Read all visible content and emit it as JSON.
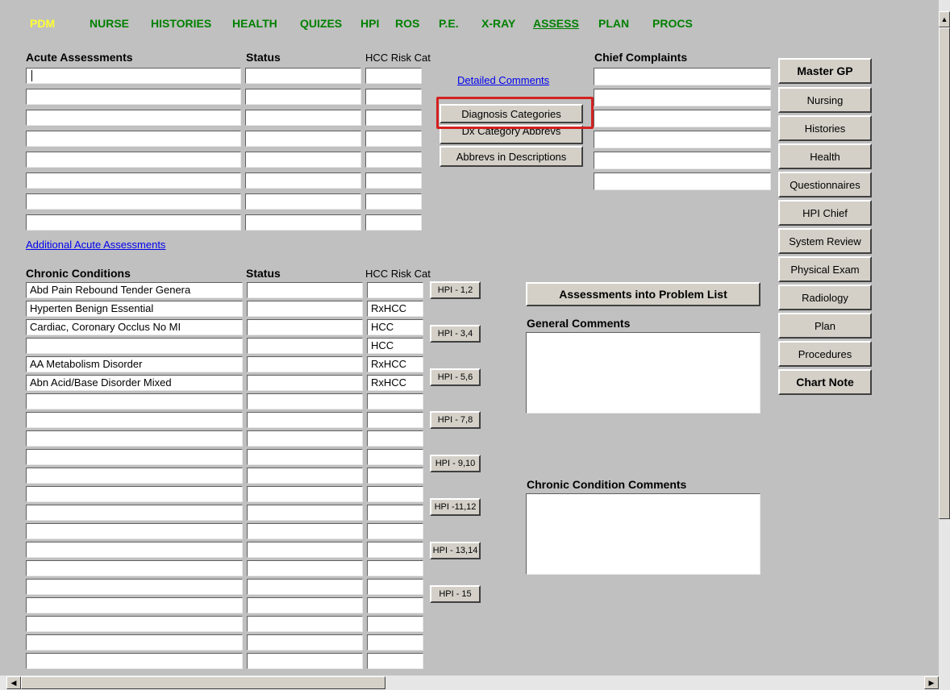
{
  "nav": [
    {
      "label": "PDM"
    },
    {
      "label": "NURSE"
    },
    {
      "label": "HISTORIES"
    },
    {
      "label": "HEALTH"
    },
    {
      "label": "QUIZES"
    },
    {
      "label": "HPI"
    },
    {
      "label": "ROS"
    },
    {
      "label": "P.E."
    },
    {
      "label": "X-RAY"
    },
    {
      "label": "ASSESS"
    },
    {
      "label": "PLAN"
    },
    {
      "label": "PROCS"
    }
  ],
  "acute": {
    "title": "Acute Assessments",
    "status_label": "Status",
    "hcc_label": "HCC Risk Cat",
    "additional_link": "Additional Acute Assessments"
  },
  "links": {
    "detailed_comments": "Detailed Comments"
  },
  "buttons": {
    "diagnosis_categories": "Diagnosis Categories",
    "dx_category_abbrevs": "Dx Category Abbrevs",
    "abbrevs_in_descriptions": "Abbrevs in Descriptions",
    "assessments_into_problem_list": "Assessments into Problem List"
  },
  "chief": {
    "title": "Chief Complaints"
  },
  "chronic": {
    "title": "Chronic Conditions",
    "status_label": "Status",
    "hcc_label": "HCC Risk Cat",
    "rows": [
      {
        "condition": "Abd Pain Rebound Tender Genera",
        "hcc": ""
      },
      {
        "condition": "Hyperten  Benign Essential",
        "hcc": "RxHCC"
      },
      {
        "condition": "Cardiac, Coronary Occlus No MI",
        "hcc": "HCC"
      },
      {
        "condition": "",
        "hcc": "HCC"
      },
      {
        "condition": "AA Metabolism Disorder",
        "hcc": "RxHCC"
      },
      {
        "condition": "Abn Acid/Base Disorder Mixed",
        "hcc": "RxHCC"
      }
    ]
  },
  "hpi_buttons": [
    "HPI - 1,2",
    "HPI - 3,4",
    "HPI - 5,6",
    "HPI - 7,8",
    "HPI - 9,10",
    "HPI -11,12",
    "HPI - 13,14",
    "HPI - 15"
  ],
  "general_comments_label": "General Comments",
  "chronic_comments_label": "Chronic Condition Comments",
  "side_buttons": [
    {
      "label": "Master GP"
    },
    {
      "label": "Nursing"
    },
    {
      "label": "Histories"
    },
    {
      "label": "Health"
    },
    {
      "label": "Questionnaires"
    },
    {
      "label": "HPI Chief"
    },
    {
      "label": "System Review"
    },
    {
      "label": "Physical Exam"
    },
    {
      "label": "Radiology"
    },
    {
      "label": "Plan"
    },
    {
      "label": "Procedures"
    },
    {
      "label": "Chart Note"
    }
  ],
  "colors": {
    "background": "#c0c0c0",
    "nav_green": "#008000",
    "nav_current": "#ffff33",
    "link_blue": "#0000ee",
    "highlight_red": "#d42020"
  }
}
